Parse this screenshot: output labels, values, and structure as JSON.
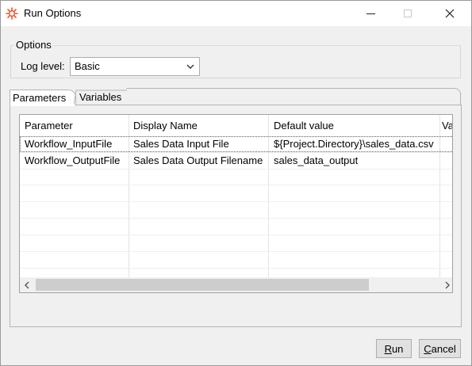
{
  "window": {
    "title": "Run Options",
    "icons": {
      "app": "gear-icon",
      "minimize": "minimize-icon",
      "maximize": "maximize-icon",
      "close": "close-icon"
    }
  },
  "options": {
    "group_label": "Options",
    "log_level_label": "Log level:",
    "log_level_value": "Basic"
  },
  "tabs": [
    {
      "label": "Parameters",
      "active": true
    },
    {
      "label": "Variables",
      "active": false
    }
  ],
  "table": {
    "columns": [
      "Parameter",
      "Display Name",
      "Default value",
      "Va"
    ],
    "rows": [
      [
        "Workflow_InputFile",
        "Sales Data Input File",
        "${Project.Directory}\\sales_data.csv"
      ],
      [
        "Workflow_OutputFile",
        "Sales Data Output Filename",
        "sales_data_output"
      ]
    ]
  },
  "buttons": {
    "run_mnemonic": "R",
    "run_rest": "un",
    "cancel_mnemonic": "C",
    "cancel_rest": "ancel"
  },
  "colors": {
    "app_icon": "#e8562f"
  }
}
